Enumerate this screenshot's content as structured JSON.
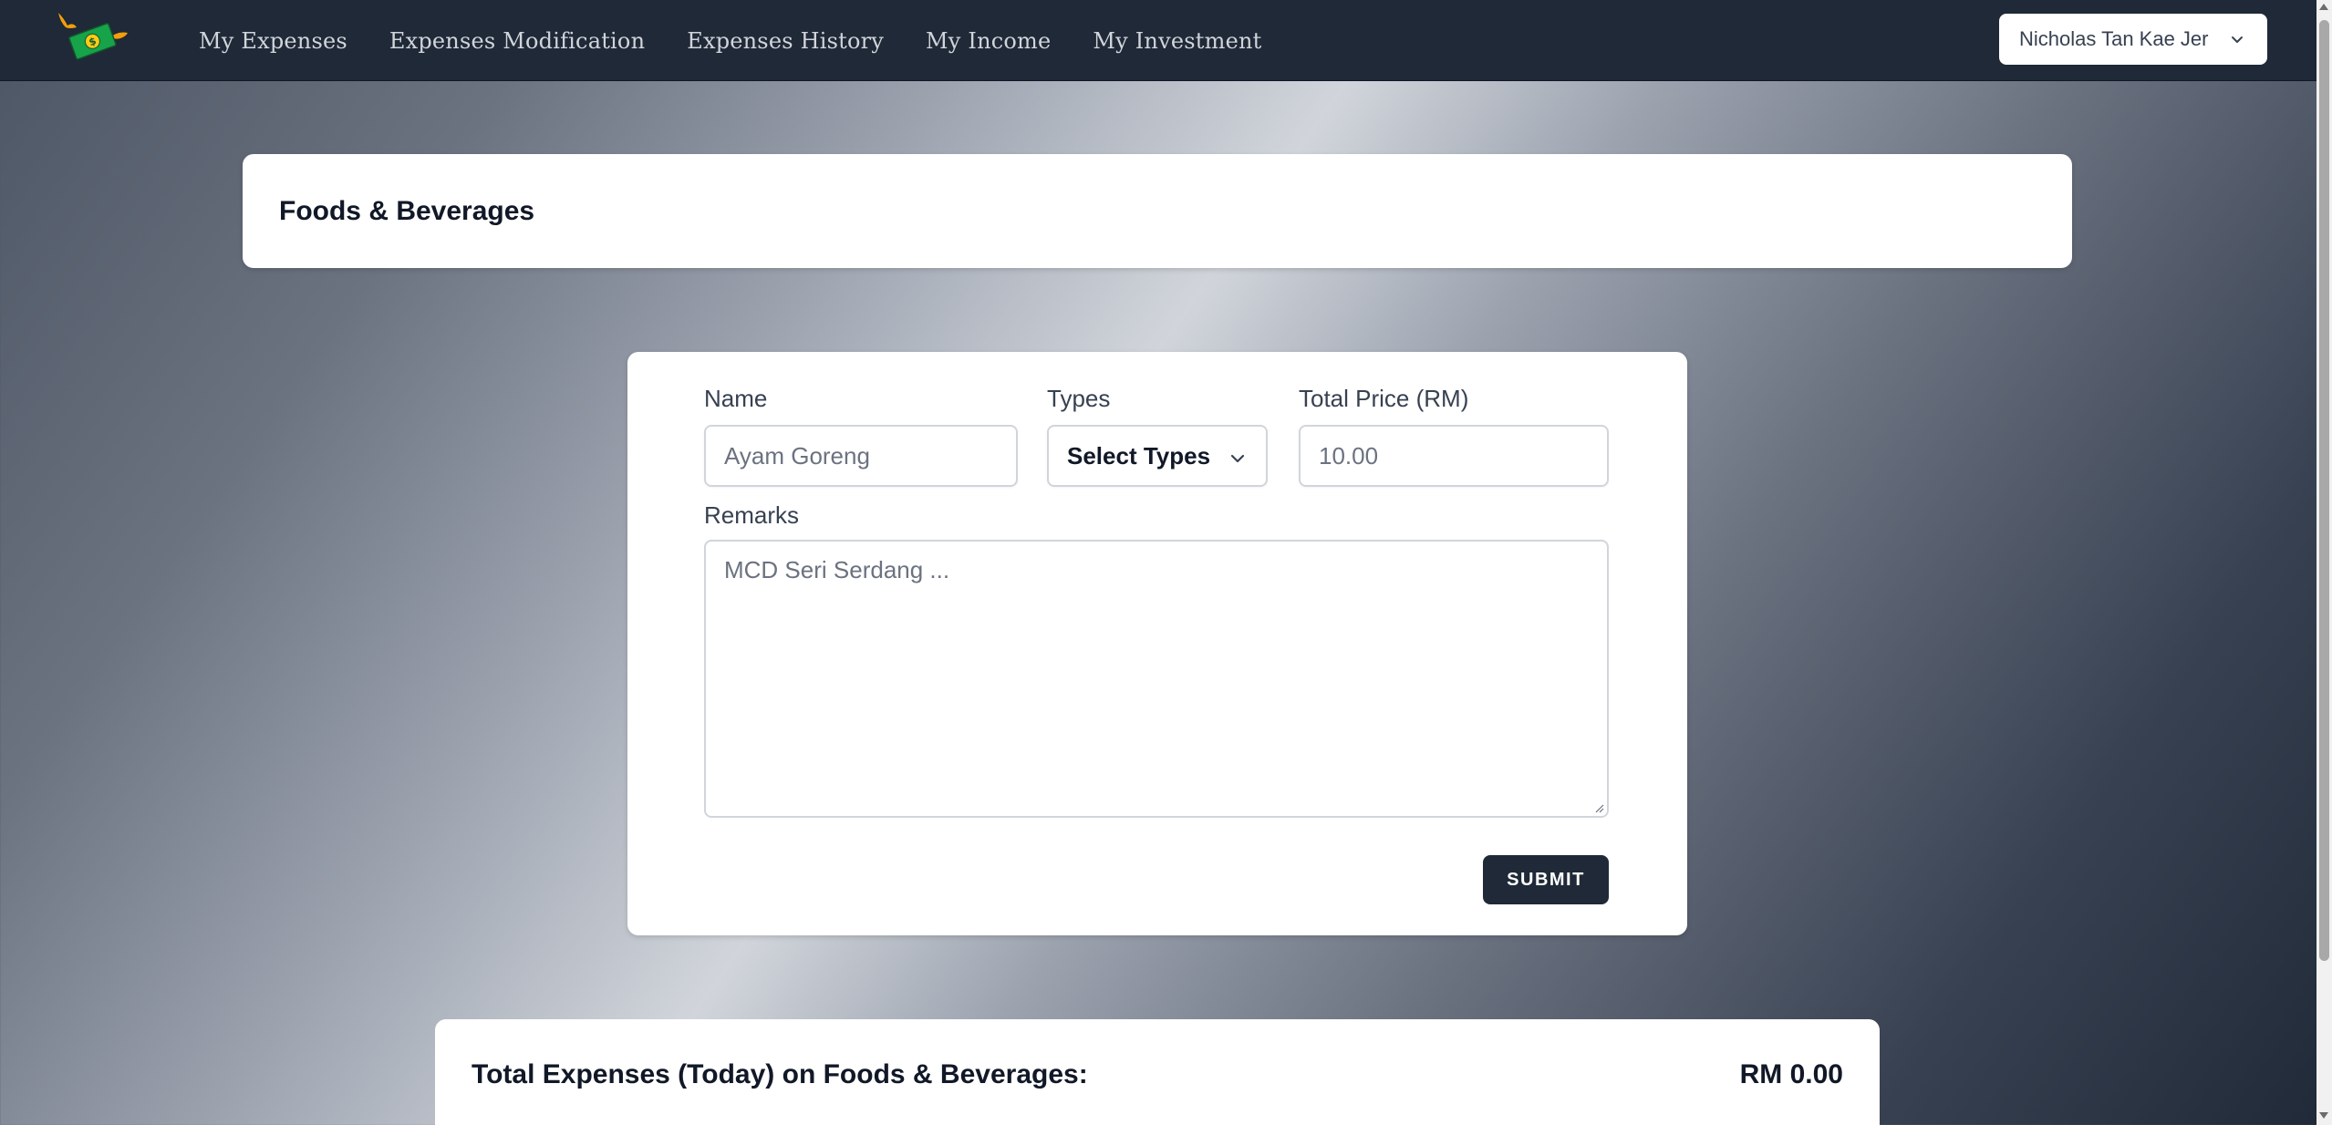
{
  "navbar": {
    "links": [
      "My Expenses",
      "Expenses Modification",
      "Expenses History",
      "My Income",
      "My Investment"
    ],
    "user_name": "Nicholas Tan Kae Jer"
  },
  "header": {
    "title": "Foods & Beverages"
  },
  "form": {
    "name_label": "Name",
    "name_placeholder": "Ayam Goreng",
    "types_label": "Types",
    "types_selected": "Select Types",
    "price_label": "Total Price (RM)",
    "price_placeholder": "10.00",
    "remarks_label": "Remarks",
    "remarks_placeholder": "MCD Seri Serdang ...",
    "submit_label": "SUBMIT"
  },
  "summary": {
    "label": "Total Expenses (Today) on Foods & Beverages:",
    "value": "RM 0.00"
  },
  "colors": {
    "nav_bg": "#1f2937",
    "button_bg": "#1f2937",
    "card_bg": "#ffffff"
  },
  "icons": {
    "logo": "flying-money-logo",
    "user_dropdown": "chevron-down-icon",
    "select_dropdown": "chevron-down-icon"
  }
}
